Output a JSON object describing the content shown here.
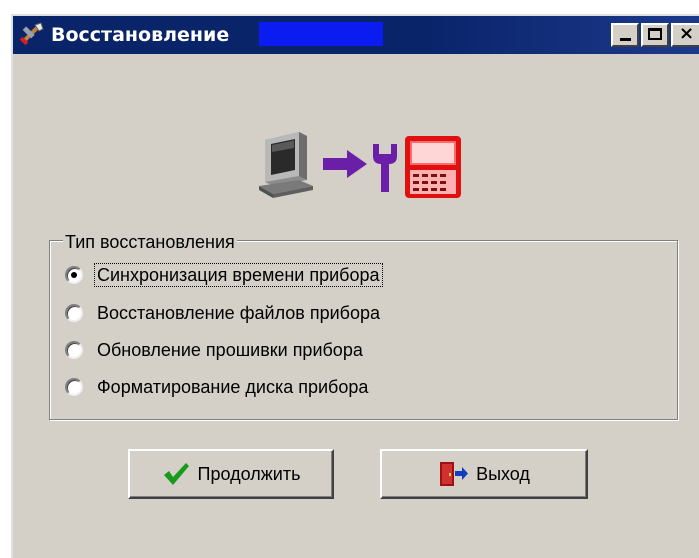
{
  "window": {
    "title": "Восстановление",
    "icon": "tools-icon",
    "controls": {
      "minimize": "minimize-icon",
      "maximize": "maximize-icon",
      "close": "×"
    }
  },
  "hero": {
    "icons": [
      "computer-icon",
      "arrow-right-icon",
      "wrench-icon",
      "device-icon"
    ]
  },
  "restore_type": {
    "legend": "Тип восстановления",
    "options": [
      {
        "label": "Синхронизация времени прибора",
        "selected": true
      },
      {
        "label": "Восстановление файлов прибора",
        "selected": false
      },
      {
        "label": "Обновление прошивки прибора",
        "selected": false
      },
      {
        "label": "Форматирование диска прибора",
        "selected": false
      }
    ]
  },
  "buttons": {
    "continue_label": "Продолжить",
    "continue_icon": "checkmark-icon",
    "exit_label": "Выход",
    "exit_icon": "exit-door-icon"
  },
  "colors": {
    "titlebar": "#0a246a",
    "face": "#d4d0c8",
    "device_red": "#e01010",
    "arrow_purple": "#6b1fa8",
    "check_green": "#1a9a1a"
  }
}
